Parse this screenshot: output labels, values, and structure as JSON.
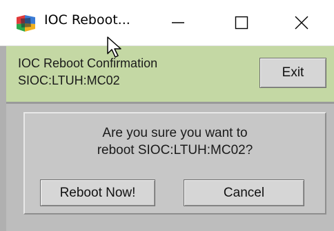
{
  "window": {
    "title": "IOC Reboot...",
    "app_icon": "colorful-app-icon",
    "controls": [
      "minimize-icon",
      "maximize-icon",
      "close-icon"
    ]
  },
  "header": {
    "line1": "IOC Reboot Confirmation",
    "line2": "SIOC:LTUH:MC02",
    "exit_label": "Exit",
    "background": "#c4d8a4"
  },
  "dialog": {
    "message_line1": "Are you sure you want to",
    "message_line2": "reboot SIOC:LTUH:MC02?",
    "reboot_label": "Reboot Now!",
    "cancel_label": "Cancel"
  }
}
